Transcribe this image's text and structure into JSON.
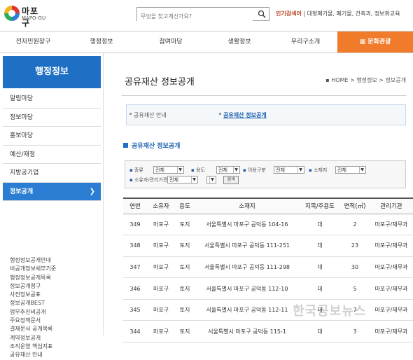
{
  "header": {
    "logo_name": "마포구",
    "logo_sub": "MAPO-GU",
    "search_placeholder": "무엇을 찾고계신가요?",
    "popular_label": "인기검색어",
    "popular_keywords": "| 대형폐기물, 폐기물, 건축과, 정보화교육"
  },
  "gnb": [
    "전자민원창구",
    "행정정보",
    "참여마당",
    "생활정보",
    "우리구소개",
    "문화관광"
  ],
  "gnb_active_index": 5,
  "sidebar": {
    "title": "행정정보",
    "menu": [
      "알림마당",
      "정보마당",
      "홍보마당",
      "예산/재정",
      "지방공기업",
      "정보공개"
    ],
    "active_index": 5,
    "submenu": [
      "행정정보공개안내",
      "비공개정보세부기준",
      "행정정보공개목록",
      "정보공개청구",
      "사전정보공표",
      "정보공개BEST",
      "업무추진비공개",
      "주요정책문서",
      "결재문서 공개목록",
      "계약정보공개",
      "조직운영 핵심지표",
      "공유재산 안내"
    ]
  },
  "main": {
    "title": "공유재산 정보공개",
    "breadcrumb": "HOME > 행정정보 > 정보공개",
    "tab_1": "공유재산 안내",
    "tab_2": "공유재산 정보공개",
    "section_title": "공유재산 정보공개"
  },
  "filter": {
    "kind_label": "종류",
    "kind_value": "전체",
    "use_label": "용도",
    "use_value": "전체",
    "move_label": "이용구분",
    "move_value": "전체",
    "loc_label": "소재지",
    "loc_value": "전체",
    "owner_label": "소유자/관리기관",
    "owner_value": "전체",
    "search_label": "검색"
  },
  "table": {
    "headers": [
      "연번",
      "소유자",
      "용도",
      "소재지",
      "지목/주용도",
      "면적(㎡)",
      "관리기관"
    ],
    "rows": [
      [
        "349",
        "마포구",
        "토지",
        "서울특별시 마포구 공덕동 104-16",
        "대",
        "2",
        "마포구/재무과"
      ],
      [
        "348",
        "마포구",
        "토지",
        "서울특별시 마포구 공덕동 111-251",
        "대",
        "23",
        "마포구/재무과"
      ],
      [
        "347",
        "마포구",
        "토지",
        "서울특별시 마포구 공덕동 111-298",
        "대",
        "30",
        "마포구/재무과"
      ],
      [
        "346",
        "마포구",
        "토지",
        "서울특별시 마포구 공덕동 112-10",
        "대",
        "5",
        "마포구/재무과"
      ],
      [
        "345",
        "마포구",
        "토지",
        "서울특별시 마포구 공덕동 112-11",
        "대",
        "7",
        "마포구/재무과"
      ],
      [
        "344",
        "마포구",
        "토지",
        "서울특별시 마포구 공덕동 115-1",
        "대",
        "3",
        "마포구/재무과"
      ]
    ]
  },
  "watermark": "한국공보뉴스",
  "colors": {
    "accent": "#1f6fc4",
    "gnb_active": "#f07b2a"
  }
}
